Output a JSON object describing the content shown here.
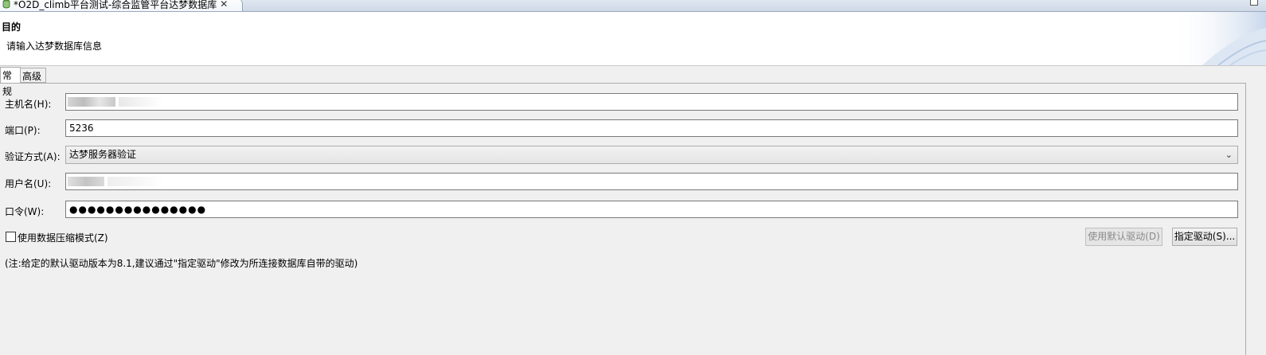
{
  "editor_tab": {
    "title": "*O2D_climb平台测试-综合监管平台达梦数据库",
    "close": "✕"
  },
  "header": {
    "title": "目的",
    "description": "请输入达梦数据库信息"
  },
  "tabs": [
    {
      "label": "常规",
      "selected": true
    },
    {
      "label": "高级",
      "selected": false
    }
  ],
  "form": {
    "host_label": "主机名(H):",
    "host_value": "",
    "port_label": "端口(P):",
    "port_value": "5236",
    "auth_label": "验证方式(A):",
    "auth_value": "达梦服务器验证",
    "user_label": "用户名(U):",
    "user_value": "",
    "password_label": "口令(W):",
    "password_value": "●●●●●●●●●●●●●●●"
  },
  "compress": {
    "label": "使用数据压缩模式(Z)",
    "checked": false
  },
  "buttons": {
    "default_driver": "使用默认驱动(D)",
    "specify_driver": "指定驱动(S)..."
  },
  "note": "(注:给定的默认驱动版本为8.1,建议通过\"指定驱动\"修改为所连接数据库自带的驱动)",
  "icons": {
    "db_icon": "database-icon",
    "chevron": "chevron-down-icon"
  }
}
